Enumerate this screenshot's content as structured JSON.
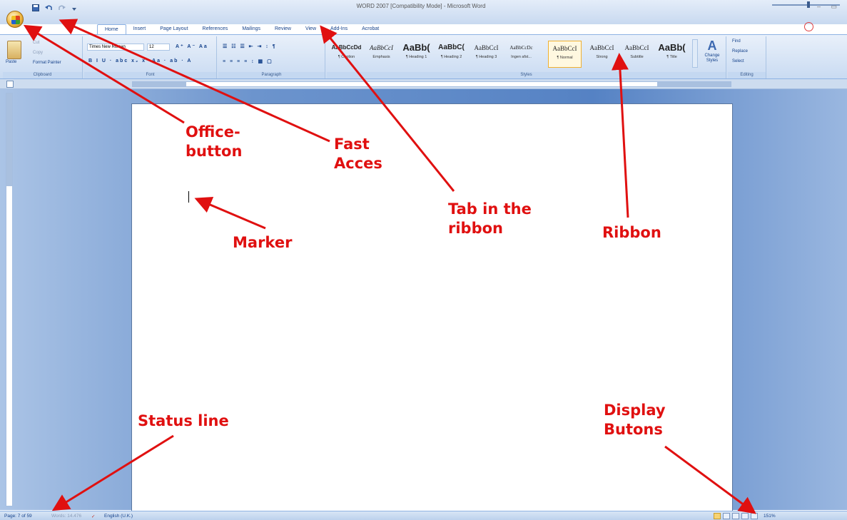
{
  "window": {
    "title": "WORD 2007 [Compatibility Mode] - Microsoft Word",
    "controls": "– ▭"
  },
  "quick_access": {
    "items": [
      "save-icon",
      "undo-icon",
      "redo-icon",
      "customize-icon"
    ]
  },
  "tabs": [
    "Home",
    "Insert",
    "Page Layout",
    "References",
    "Mailings",
    "Review",
    "View",
    "Add-Ins",
    "Acrobat"
  ],
  "active_tab": "Home",
  "ribbon": {
    "clipboard": {
      "paste": "Paste",
      "cut": "Cut",
      "copy": "Copy",
      "format_painter": "Format Painter",
      "label": "Clipboard"
    },
    "font": {
      "family": "Times New Roman",
      "size": "12",
      "buttons_row1": "A⁺ A⁻ Aa",
      "buttons_row2": "B I U · abc x₂ x² Aa · ab · A",
      "label": "Font"
    },
    "paragraph": {
      "buttons_row1": "☰ ☷ ☰ ⇤ ⇥ ↕ ¶",
      "buttons_row2": "≡ ≡ ≡ ≡ ↕ ▦ ▢",
      "label": "Paragraph"
    },
    "styles": {
      "items": [
        {
          "sample": "AaBbCcDd",
          "name": "¶ Caption"
        },
        {
          "sample": "AaBbCcI",
          "name": "Emphasis"
        },
        {
          "sample": "AaBb(",
          "name": "¶ Heading 1"
        },
        {
          "sample": "AaBbC(",
          "name": "¶ Heading 2"
        },
        {
          "sample": "AaBbCcI",
          "name": "¶ Heading 3"
        },
        {
          "sample": "AaBbCcDc",
          "name": "Ingen afst..."
        },
        {
          "sample": "AaBbCcI",
          "name": "¶ Normal"
        },
        {
          "sample": "AaBbCcI",
          "name": "Strong"
        },
        {
          "sample": "AaBbCcI",
          "name": "Subtitle"
        },
        {
          "sample": "AaBb(",
          "name": "¶ Title"
        }
      ],
      "selected_index": 6,
      "change_styles": "Change Styles",
      "label": "Styles"
    },
    "editing": {
      "find": "Find",
      "replace": "Replace",
      "select": "Select",
      "label": "Editing"
    }
  },
  "statusbar": {
    "page": "Page: 7 of 59",
    "words": "Words: 14.476",
    "language": "English (U.K.)",
    "zoom": "151%"
  },
  "annotations": {
    "office_button": "Office-\nbutton",
    "fast_access": "Fast\nAcces",
    "tab_in_ribbon": "Tab in the\nribbon",
    "ribbon": "Ribbon",
    "marker": "Marker",
    "status_line": "Status line",
    "display_buttons": "Display\nButons",
    "color": "#e01010"
  }
}
